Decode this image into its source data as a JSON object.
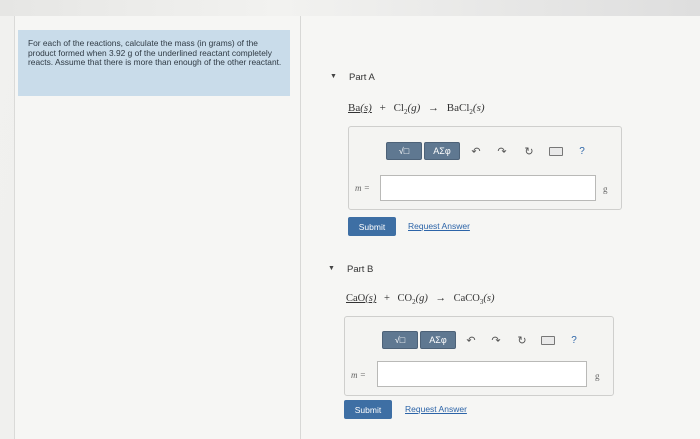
{
  "intro": {
    "text": "For each of the reactions, calculate the mass (in grams) of the product formed when 3.92 g of the underlined reactant completely reacts. Assume that there is more than enough of the other reactant."
  },
  "parts": [
    {
      "title": "Part A",
      "toggle_icon": "caret-down-icon",
      "equation": {
        "reactant1": "Ba",
        "reactant1_state": "(s)",
        "plus": "+",
        "reactant2": "Cl",
        "reactant2_sub": "2",
        "reactant2_state": "(g)",
        "arrow": "→",
        "product": "BaCl",
        "product_sub": "2",
        "product_state": "(s)"
      },
      "toolbar": {
        "templates_label": "√□",
        "symbols_label": "ΑΣφ",
        "undo_icon": "undo-icon",
        "redo_icon": "redo-icon",
        "reset_icon": "reset-icon",
        "keyboard_icon": "keyboard-icon",
        "help_label": "?"
      },
      "variable": "m =",
      "input_value": "",
      "unit": "g",
      "submit_label": "Submit",
      "request_label": "Request Answer"
    },
    {
      "title": "Part B",
      "toggle_icon": "caret-down-icon",
      "equation": {
        "reactant1": "CaO",
        "reactant1_state": "(s)",
        "plus": "+",
        "reactant2": "CO",
        "reactant2_sub": "2",
        "reactant2_state": "(g)",
        "arrow": "→",
        "product": "CaCO",
        "product_sub": "3",
        "product_state": "(s)"
      },
      "toolbar": {
        "templates_label": "√□",
        "symbols_label": "ΑΣφ",
        "undo_icon": "undo-icon",
        "redo_icon": "redo-icon",
        "reset_icon": "reset-icon",
        "keyboard_icon": "keyboard-icon",
        "help_label": "?"
      },
      "variable": "m =",
      "input_value": "",
      "unit": "g",
      "submit_label": "Submit",
      "request_label": "Request Answer"
    }
  ],
  "colors": {
    "intro_bg": "#c9dcea",
    "toolbar_btn": "#5f7891",
    "submit_btn": "#3e6fa4",
    "link": "#2c64a8"
  }
}
